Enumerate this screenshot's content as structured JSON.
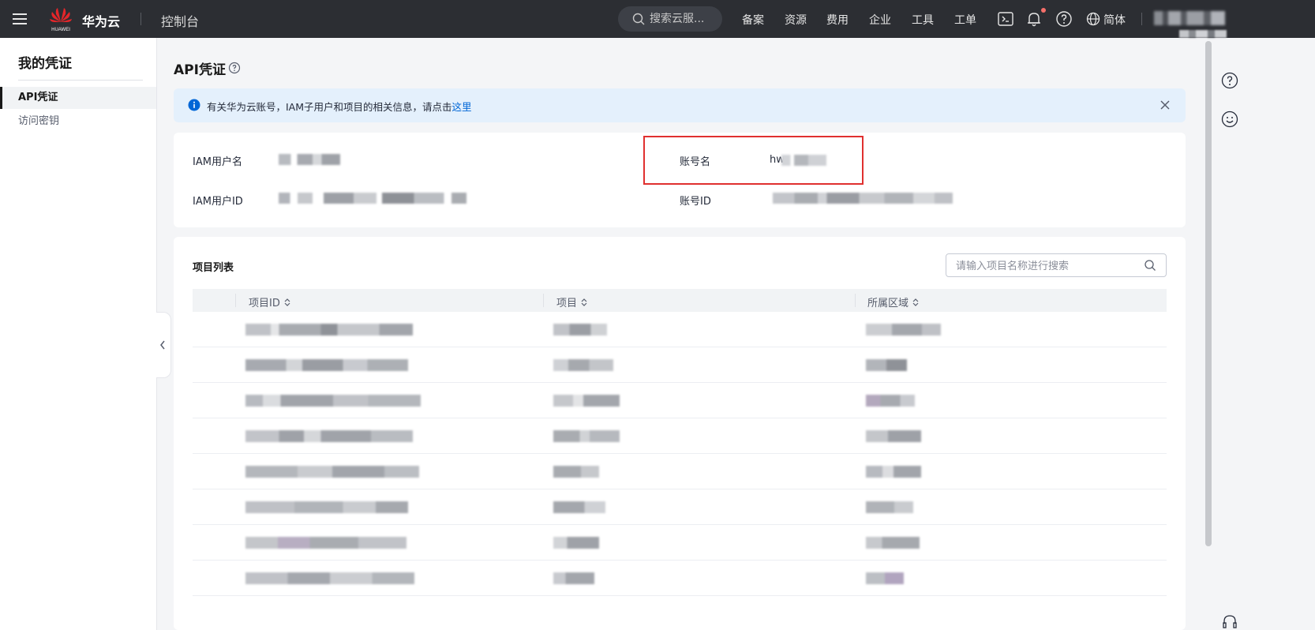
{
  "topbar": {
    "brand": "华为云",
    "brand_sub": "HUAWEI",
    "console": "控制台",
    "search_placeholder": "搜索云服...",
    "nav": [
      "备案",
      "资源",
      "费用",
      "企业",
      "工具",
      "工单"
    ],
    "language": "简体"
  },
  "sidebar": {
    "title": "我的凭证",
    "items": [
      {
        "label": "API凭证",
        "active": true
      },
      {
        "label": "访问密钥",
        "active": false
      }
    ]
  },
  "main": {
    "title": "API凭证",
    "alert": {
      "text": "有关华为云账号，IAM子用户和项目的相关信息，请点击",
      "link": "这里"
    },
    "info": {
      "iam_user_label": "IAM用户名",
      "iam_user_id_label": "IAM用户ID",
      "account_label": "账号名",
      "account_prefix": "hw",
      "account_id_label": "账号ID"
    },
    "projects": {
      "title": "项目列表",
      "search_placeholder": "请输入项目名称进行搜索",
      "columns": [
        "项目ID",
        "项目",
        "所属区域"
      ]
    }
  },
  "colors": {
    "topbar_bg": "#2c2e33",
    "alert_bg": "#e4f0fc",
    "link": "#0066d6",
    "highlight_box": "#e0302f",
    "notification_dot": "#f66f6a"
  },
  "icons": [
    "menu-icon",
    "huawei-logo",
    "search-icon",
    "terminal-icon",
    "bell-icon",
    "help-icon",
    "globe-icon",
    "info-icon",
    "close-icon",
    "chevron-left-icon",
    "sort-icon",
    "smile-icon",
    "headset-icon"
  ]
}
